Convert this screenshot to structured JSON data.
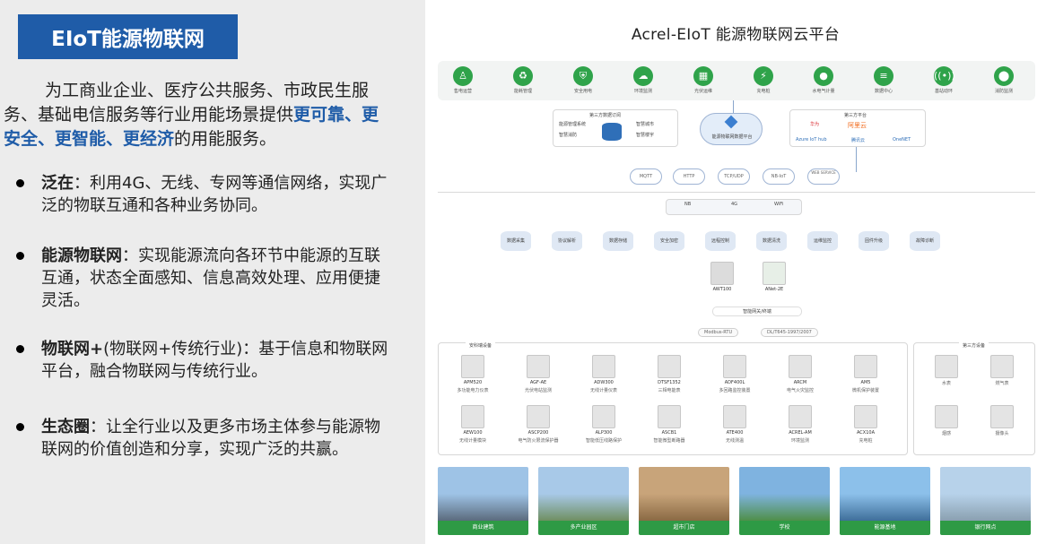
{
  "left": {
    "title": "EIoT能源物联网",
    "intro_plain": "为工商业企业、医疗公共服务、市政民生服务、基础电信服务等行业用能场景提供",
    "intro_highlight": "更可靠、更安全、更智能、更经济",
    "intro_tail": "的用能服务。",
    "bullets": [
      {
        "term": "泛在",
        "sep": "：",
        "text": "利用4G、无线、专网等通信网络，实现广泛的物联互通和各种业务协同。"
      },
      {
        "term": "能源物联网",
        "sep": "：",
        "text": "实现能源流向各环节中能源的互联互通，状态全面感知、信息高效处理、应用便捷灵活。"
      },
      {
        "term": "物联网+",
        "sep": "",
        "text": "(物联网+传统行业)：基于信息和物联网平台，融合物联网与传统行业。"
      },
      {
        "term": "生态圈",
        "sep": "：",
        "text": "让全行业以及更多市场主体参与能源物联网的价值创造和分享，实现广泛的共赢。"
      }
    ]
  },
  "diagram": {
    "title": "Acrel-EIoT 能源物联网云平台",
    "accent_green": "#2fa34a",
    "accent_blue": "#1f5ca8",
    "apps": [
      {
        "icon": "person-icon",
        "glyph": "♙",
        "label": "售电运营"
      },
      {
        "icon": "recycle-icon",
        "glyph": "♻",
        "label": "能耗管理"
      },
      {
        "icon": "shield-icon",
        "glyph": "⛨",
        "label": "安全用电"
      },
      {
        "icon": "cloud-icon",
        "glyph": "☁",
        "label": "环境监测"
      },
      {
        "icon": "building-icon",
        "glyph": "▦",
        "label": "光伏运维"
      },
      {
        "icon": "charger-icon",
        "glyph": "⚡",
        "label": "充电桩"
      },
      {
        "icon": "drop-icon",
        "glyph": "●",
        "label": "水电气计量"
      },
      {
        "icon": "database-icon",
        "glyph": "≡",
        "label": "数据中心"
      },
      {
        "icon": "signal-icon",
        "glyph": "((•))",
        "label": "基站动环"
      },
      {
        "icon": "pin-icon",
        "glyph": "⬤",
        "label": "消防监测"
      }
    ],
    "third_party_sub": {
      "title": "第三方数据订阅",
      "items": [
        "能源管理系统",
        "智慧消防",
        "智慧城市",
        "智慧楼宇"
      ]
    },
    "platform_label": "能源物联网数据平台",
    "third_party_platforms": {
      "title": "第三方平台",
      "items": [
        "华为",
        "阿里云",
        "Azure IoT hub",
        "腾讯云",
        "OneNET"
      ]
    },
    "protocols": [
      "MQTT",
      "HTTP",
      "TCP/UDP",
      "NB-IoT",
      "WEB SERVICE"
    ],
    "networks": [
      "NB",
      "4G",
      "WiFi"
    ],
    "functions": [
      "数据采集",
      "协议解析",
      "数据存储",
      "安全加密",
      "远程控制",
      "数据清洗",
      "运维监控",
      "固件升级",
      "故障诊断"
    ],
    "gateways": [
      {
        "name": "AWT100",
        "label": ""
      },
      {
        "name": "ANet-2E",
        "label": ""
      }
    ],
    "gateway_caption": "智能网关/终端",
    "bus_labels": [
      "Modbus-RTU",
      "DL/T645-1997/2007"
    ],
    "device_group_title": "安科瑞设备",
    "third_device_title": "第三方设备",
    "devices_row1": [
      {
        "name": "APM520",
        "desc": "多功能电力仪表"
      },
      {
        "name": "AGF-AE",
        "desc": "光伏电站监测"
      },
      {
        "name": "ADW300",
        "desc": "无线计量仪表"
      },
      {
        "name": "DTSF1352",
        "desc": "三相电能表"
      },
      {
        "name": "ADF400L",
        "desc": "多回路监控装置"
      },
      {
        "name": "ARCM",
        "desc": "电气火灾监控"
      },
      {
        "name": "AM5",
        "desc": "微机保护装置"
      }
    ],
    "devices_row2": [
      {
        "name": "AEW100",
        "desc": "无线计量模块"
      },
      {
        "name": "ASCP200",
        "desc": "电气防火限流保护器"
      },
      {
        "name": "ALP300",
        "desc": "智能低压线路保护"
      },
      {
        "name": "ASCB1",
        "desc": "智能微型断路器"
      },
      {
        "name": "ATE400",
        "desc": "无线测温"
      },
      {
        "name": "ACREL-AM",
        "desc": "环境监测"
      },
      {
        "name": "ACX10A",
        "desc": "充电桩"
      }
    ],
    "third_devices": [
      {
        "name": "",
        "desc": "水表"
      },
      {
        "name": "",
        "desc": "燃气表"
      },
      {
        "name": "",
        "desc": "烟感"
      },
      {
        "name": "",
        "desc": "摄像头"
      }
    ],
    "scenes": [
      {
        "label": "商业建筑",
        "sky": "#9ec3e6",
        "ground": "#5b6b7d"
      },
      {
        "label": "多产业园区",
        "sky": "#a8c9e8",
        "ground": "#6f8f62"
      },
      {
        "label": "超市门店",
        "sky": "#c8a47a",
        "ground": "#8a6a44"
      },
      {
        "label": "学校",
        "sky": "#7fb3e0",
        "ground": "#4f8f4a"
      },
      {
        "label": "能源基地",
        "sky": "#8cc0ea",
        "ground": "#3f6f9a"
      },
      {
        "label": "银行网点",
        "sky": "#b7d2ea",
        "ground": "#8aa0b0"
      }
    ]
  }
}
